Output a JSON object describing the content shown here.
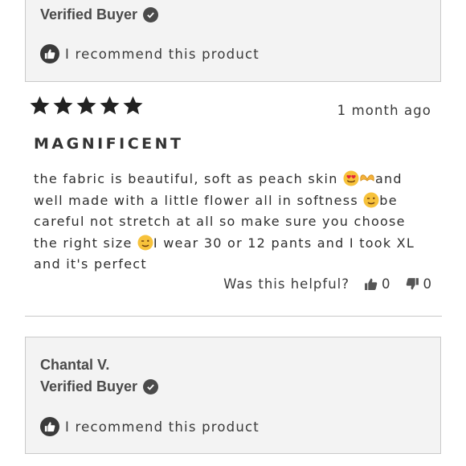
{
  "top_card": {
    "verified_label": "Verified Buyer",
    "recommend_text": "I recommend this product"
  },
  "review": {
    "rating": 5,
    "date": "1 month ago",
    "title": "MAGNIFICENT",
    "body": {
      "part1": "the fabric is beautiful, soft as peach skin ",
      "part2": "and well made with a little flower all in softness ",
      "part3": "be careful not stretch at all so make sure you choose the right size ",
      "part4": "I wear 30 or 12 pants and I took XL and it's perfect"
    },
    "helpful_label": "Was this helpful?",
    "upvotes": "0",
    "downvotes": "0"
  },
  "bottom_card": {
    "author": "Chantal V.",
    "verified_label": "Verified Buyer",
    "recommend_text": "I recommend this product"
  },
  "colors": {
    "star": "#222222",
    "card_bg": "#f3f3f3",
    "border": "#c9c9c9"
  }
}
